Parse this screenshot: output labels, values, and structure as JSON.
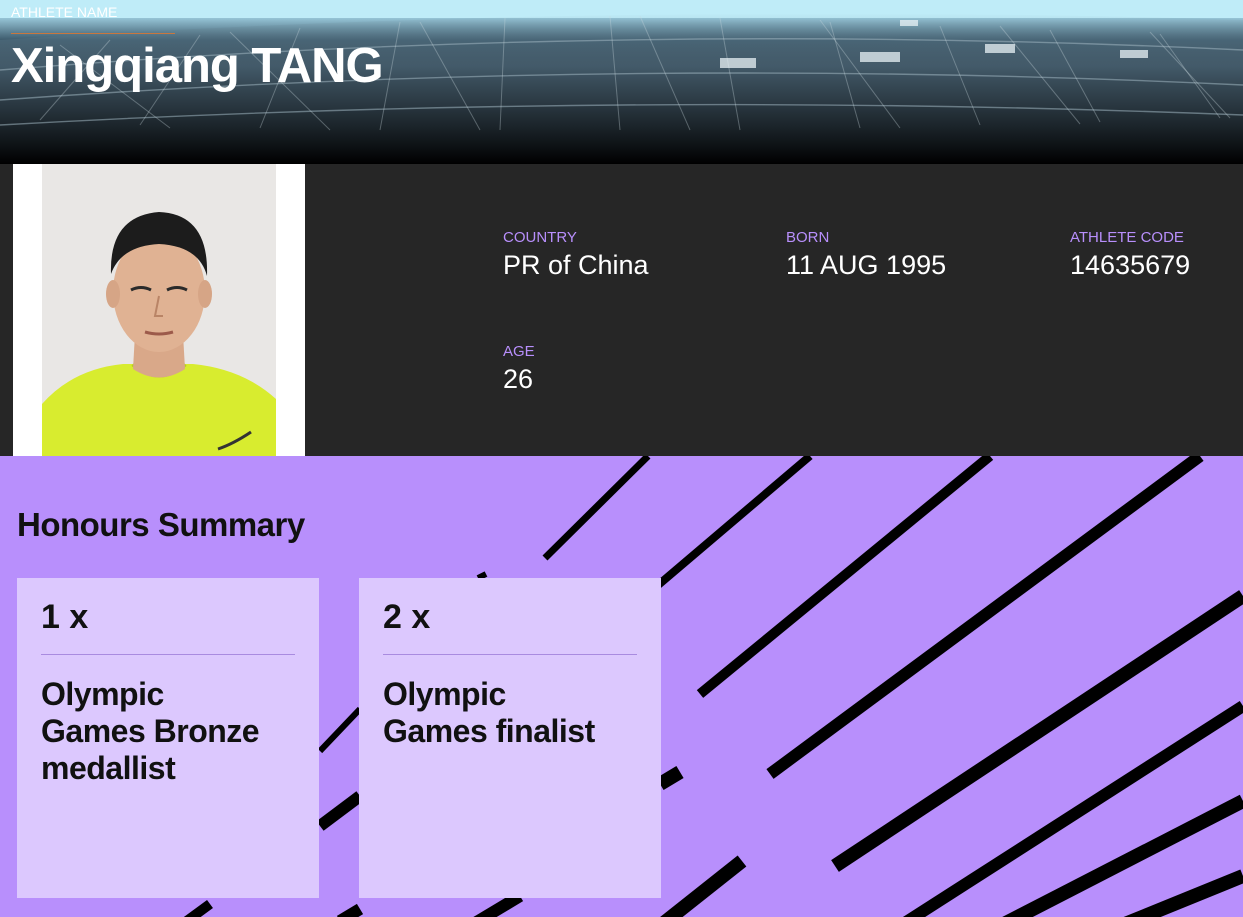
{
  "header": {
    "label": "ATHLETE NAME",
    "athlete_name": "Xingqiang TANG"
  },
  "profile": {
    "country_label": "COUNTRY",
    "country": "PR of China",
    "born_label": "BORN",
    "born": "11 AUG 1995",
    "code_label": "ATHLETE CODE",
    "code": "14635679",
    "age_label": "AGE",
    "age": "26"
  },
  "honours": {
    "title": "Honours Summary",
    "cards": [
      {
        "count": "1 x",
        "description": "Olympic Games Bronze medallist"
      },
      {
        "count": "2 x",
        "description": "Olympic Games finalist"
      }
    ]
  },
  "colors": {
    "accent_purple": "#b88ffc",
    "card_purple": "#dcc8fe",
    "panel_dark": "#262626"
  }
}
